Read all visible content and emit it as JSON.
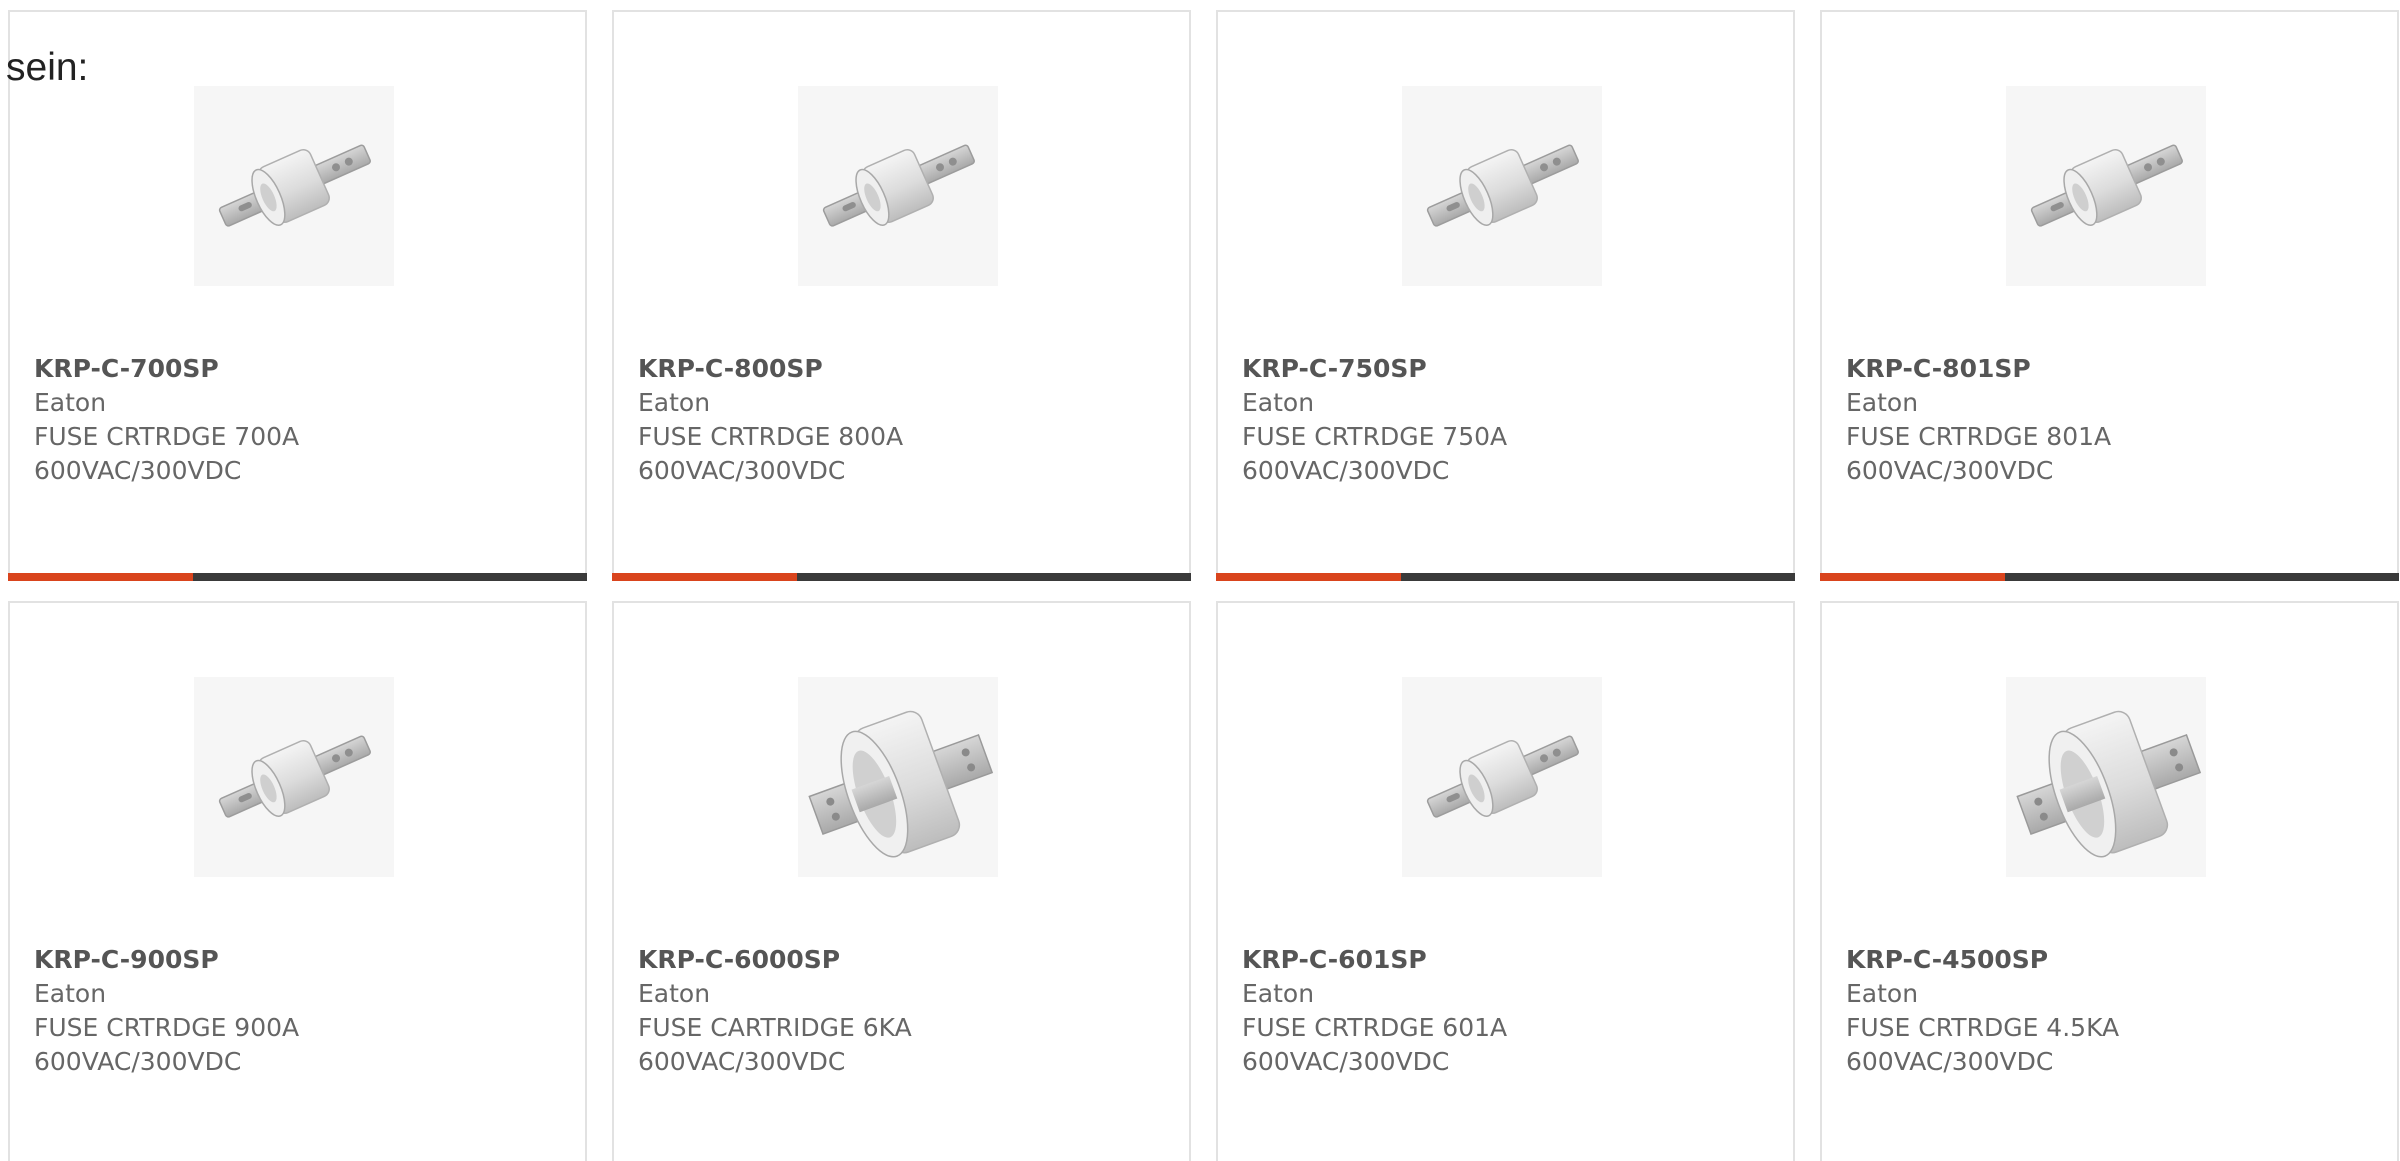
{
  "intro_text": "sein:",
  "accent_color": "#d9441d",
  "bar_color": "#3a3a3a",
  "products": [
    {
      "part_number": "KRP-C-700SP",
      "manufacturer": "Eaton",
      "desc_line1": "FUSE CRTRDGE 700A",
      "desc_line2": "600VAC/300VDC",
      "image_icon": "fuse-bolt-small-icon"
    },
    {
      "part_number": "KRP-C-800SP",
      "manufacturer": "Eaton",
      "desc_line1": "FUSE CRTRDGE 800A",
      "desc_line2": "600VAC/300VDC",
      "image_icon": "fuse-bolt-small-icon"
    },
    {
      "part_number": "KRP-C-750SP",
      "manufacturer": "Eaton",
      "desc_line1": "FUSE CRTRDGE 750A",
      "desc_line2": "600VAC/300VDC",
      "image_icon": "fuse-bolt-small-icon"
    },
    {
      "part_number": "KRP-C-801SP",
      "manufacturer": "Eaton",
      "desc_line1": "FUSE CRTRDGE 801A",
      "desc_line2": "600VAC/300VDC",
      "image_icon": "fuse-bolt-small-icon"
    },
    {
      "part_number": "KRP-C-900SP",
      "manufacturer": "Eaton",
      "desc_line1": "FUSE CRTRDGE 900A",
      "desc_line2": "600VAC/300VDC",
      "image_icon": "fuse-bolt-small-icon"
    },
    {
      "part_number": "KRP-C-6000SP",
      "manufacturer": "Eaton",
      "desc_line1": "FUSE CARTRIDGE 6KA",
      "desc_line2": "600VAC/300VDC",
      "image_icon": "fuse-bolt-large-icon"
    },
    {
      "part_number": "KRP-C-601SP",
      "manufacturer": "Eaton",
      "desc_line1": "FUSE CRTRDGE 601A",
      "desc_line2": "600VAC/300VDC",
      "image_icon": "fuse-bolt-small-icon"
    },
    {
      "part_number": "KRP-C-4500SP",
      "manufacturer": "Eaton",
      "desc_line1": "FUSE CRTRDGE 4.5KA",
      "desc_line2": "600VAC/300VDC",
      "image_icon": "fuse-bolt-large-icon"
    }
  ]
}
